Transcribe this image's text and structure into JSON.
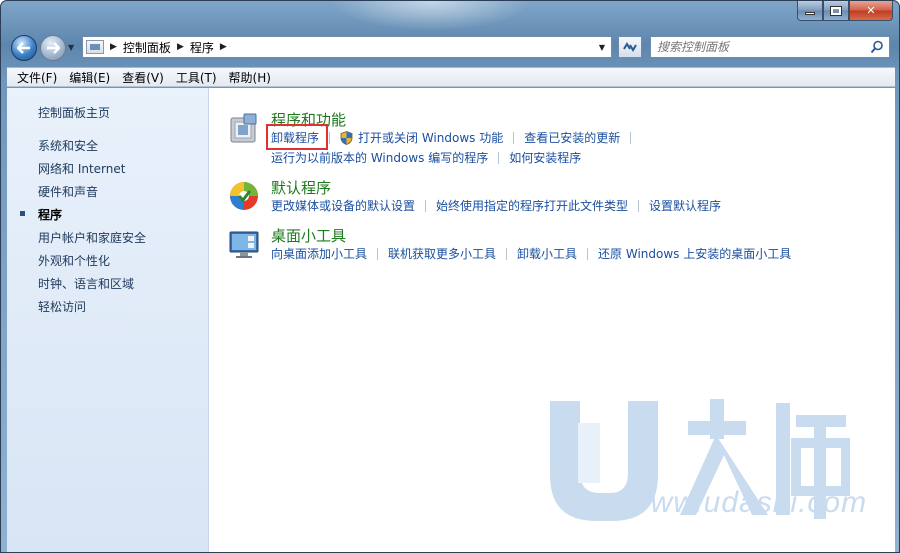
{
  "window": {
    "caption": {
      "minimize": "",
      "maximize": "",
      "close": "✕"
    }
  },
  "navigation": {
    "back_icon": "back-arrow-icon",
    "forward_icon": "forward-arrow-icon",
    "recent_icon": "chevron-down-icon",
    "breadcrumb": [
      "控制面板",
      "程序"
    ],
    "refresh_icon": "refresh-icon",
    "search": {
      "placeholder": "搜索控制面板",
      "icon": "search-icon"
    }
  },
  "menu": [
    "文件(F)",
    "编辑(E)",
    "查看(V)",
    "工具(T)",
    "帮助(H)"
  ],
  "sidebar": {
    "home": "控制面板主页",
    "items": [
      {
        "label": "系统和安全",
        "current": false
      },
      {
        "label": "网络和 Internet",
        "current": false
      },
      {
        "label": "硬件和声音",
        "current": false
      },
      {
        "label": "程序",
        "current": true
      },
      {
        "label": "用户帐户和家庭安全",
        "current": false
      },
      {
        "label": "外观和个性化",
        "current": false
      },
      {
        "label": "时钟、语言和区域",
        "current": false
      },
      {
        "label": "轻松访问",
        "current": false
      }
    ]
  },
  "categories": [
    {
      "title": "程序和功能",
      "icon": "programs-and-features-icon",
      "rows": [
        [
          "卸载程序",
          "打开或关闭 Windows 功能",
          "查看已安装的更新"
        ],
        [
          "运行为以前版本的 Windows 编写的程序",
          "如何安装程序"
        ]
      ]
    },
    {
      "title": "默认程序",
      "icon": "default-programs-icon",
      "rows": [
        [
          "更改媒体或设备的默认设置",
          "始终使用指定的程序打开此文件类型",
          "设置默认程序"
        ]
      ]
    },
    {
      "title": "桌面小工具",
      "icon": "desktop-gadgets-icon",
      "rows": [
        [
          "向桌面添加小工具",
          "联机获取更多小工具",
          "卸载小工具",
          "还原 Windows 上安装的桌面小工具"
        ]
      ]
    }
  ],
  "watermark": {
    "brand": "U大师",
    "domain": "www.udashi.com"
  },
  "colors": {
    "link": "#1a4fa0",
    "category_title": "#1e7a1e",
    "highlight": "#e03030",
    "watermark": "#c9dbef"
  }
}
